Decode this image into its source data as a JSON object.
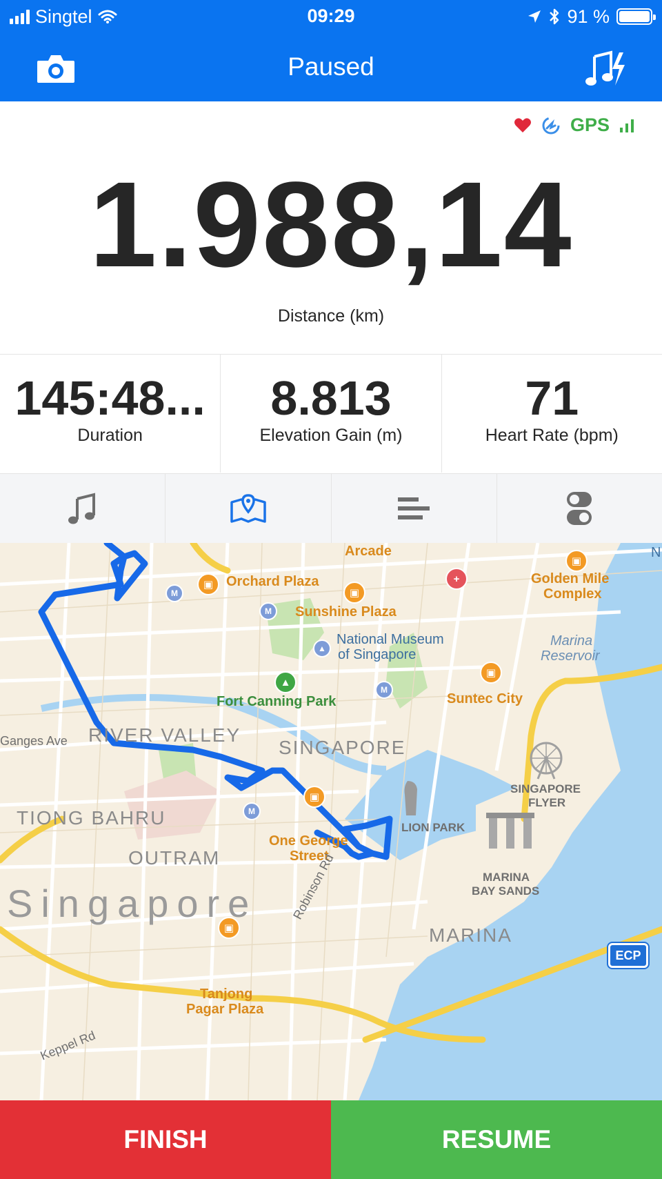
{
  "status_bar": {
    "carrier": "Singtel",
    "time": "09:29",
    "battery": "91 %"
  },
  "header": {
    "title": "Paused",
    "camera_icon": "camera-icon",
    "music_icon": "music-lightning-icon"
  },
  "indicators": {
    "gps_label": "GPS"
  },
  "main": {
    "distance_value": "1.988,14",
    "distance_label": "Distance (km)"
  },
  "stats": [
    {
      "value": "145:48...",
      "label": "Duration"
    },
    {
      "value": "8.813",
      "label": "Elevation Gain (m)"
    },
    {
      "value": "71",
      "label": "Heart Rate (bpm)"
    }
  ],
  "tabs": [
    {
      "icon": "music-note-icon",
      "active": false
    },
    {
      "icon": "map-icon",
      "active": true
    },
    {
      "icon": "splits-icon",
      "active": false
    },
    {
      "icon": "settings-toggle-icon",
      "active": false
    }
  ],
  "map": {
    "labels": {
      "arcade": "Arcade",
      "orchard_plaza": "Orchard Plaza",
      "golden_mile": "Golden Mile",
      "golden_mile_2": "Complex",
      "sunshine_plaza": "Sunshine Plaza",
      "national_museum": "National Museum",
      "national_museum_2": "of Singapore",
      "marina_reservoir": "Marina",
      "marina_reservoir_2": "Reservoir",
      "fort_canning": "Fort Canning Park",
      "suntec": "Suntec City",
      "ganges": "Ganges Ave",
      "river_valley": "RIVER VALLEY",
      "singapore_district": "SINGAPORE",
      "singapore_flyer": "SINGAPORE",
      "singapore_flyer_2": "FLYER",
      "tiong_bahru": "TIONG BAHRU",
      "merlion": "LION PARK",
      "one_george": "One George",
      "one_george_2": "Street",
      "outram": "OUTRAM",
      "marina_bay_sands": "MARINA",
      "marina_bay_sands_2": "BAY SANDS",
      "singapore_big": "Singapore",
      "marina": "MARINA",
      "robinson": "Robinson Rd",
      "ecp": "ECP",
      "tanjong": "Tanjong",
      "tanjong_2": "Pagar Plaza",
      "keppel": "Keppel Rd",
      "edge_n": "N"
    }
  },
  "actions": {
    "finish": "FINISH",
    "resume": "RESUME"
  },
  "colors": {
    "header": "#0a74f0",
    "finish": "#e33036",
    "resume": "#4db94f",
    "route": "#1769e8",
    "gps": "#3fae49",
    "heart": "#e0283a"
  }
}
